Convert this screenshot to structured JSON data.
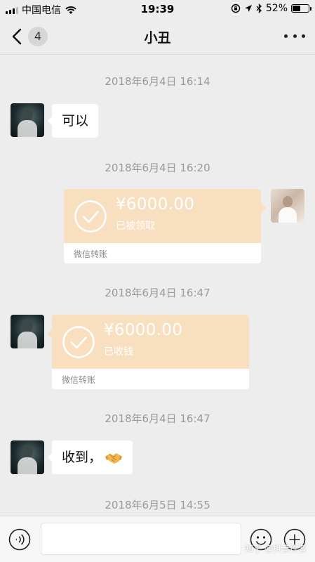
{
  "status_bar": {
    "carrier": "中国电信",
    "time": "19:39",
    "battery_percent": "52%",
    "battery_level": 0.52,
    "icons": [
      "signal-icon",
      "wifi-icon",
      "orientation-lock-icon",
      "location-icon",
      "bluetooth-icon",
      "battery-icon"
    ]
  },
  "nav": {
    "back_icon": "chevron-left-icon",
    "unread_count": "4",
    "title": "小丑",
    "more_icon": "more-dots-icon"
  },
  "messages": {
    "ts1": "2018年6月4日 16:14",
    "msg1_text": "可以",
    "ts2": "2018年6月4日 16:20",
    "transfer1": {
      "amount": "¥6000.00",
      "status": "已被领取",
      "label": "微信转账"
    },
    "ts3": "2018年6月4日 16:47",
    "transfer2": {
      "amount": "¥6000.00",
      "status": "已收钱",
      "label": "微信转账"
    },
    "ts4": "2018年6月4日 16:47",
    "msg2_text": "收到，",
    "msg2_emoji": "handshake-emoji",
    "ts5": "2018年6月5日 14:55"
  },
  "input_bar": {
    "voice_icon": "voice-icon",
    "emoji_icon": "emoji-icon",
    "add_icon": "plus-circle-icon"
  },
  "watermark": "知乎 @抖音作者",
  "colors": {
    "background": "#ededed",
    "transfer_bg": "#f8dfbf",
    "timestamp": "#9a9a9a",
    "bubble": "#ffffff"
  }
}
